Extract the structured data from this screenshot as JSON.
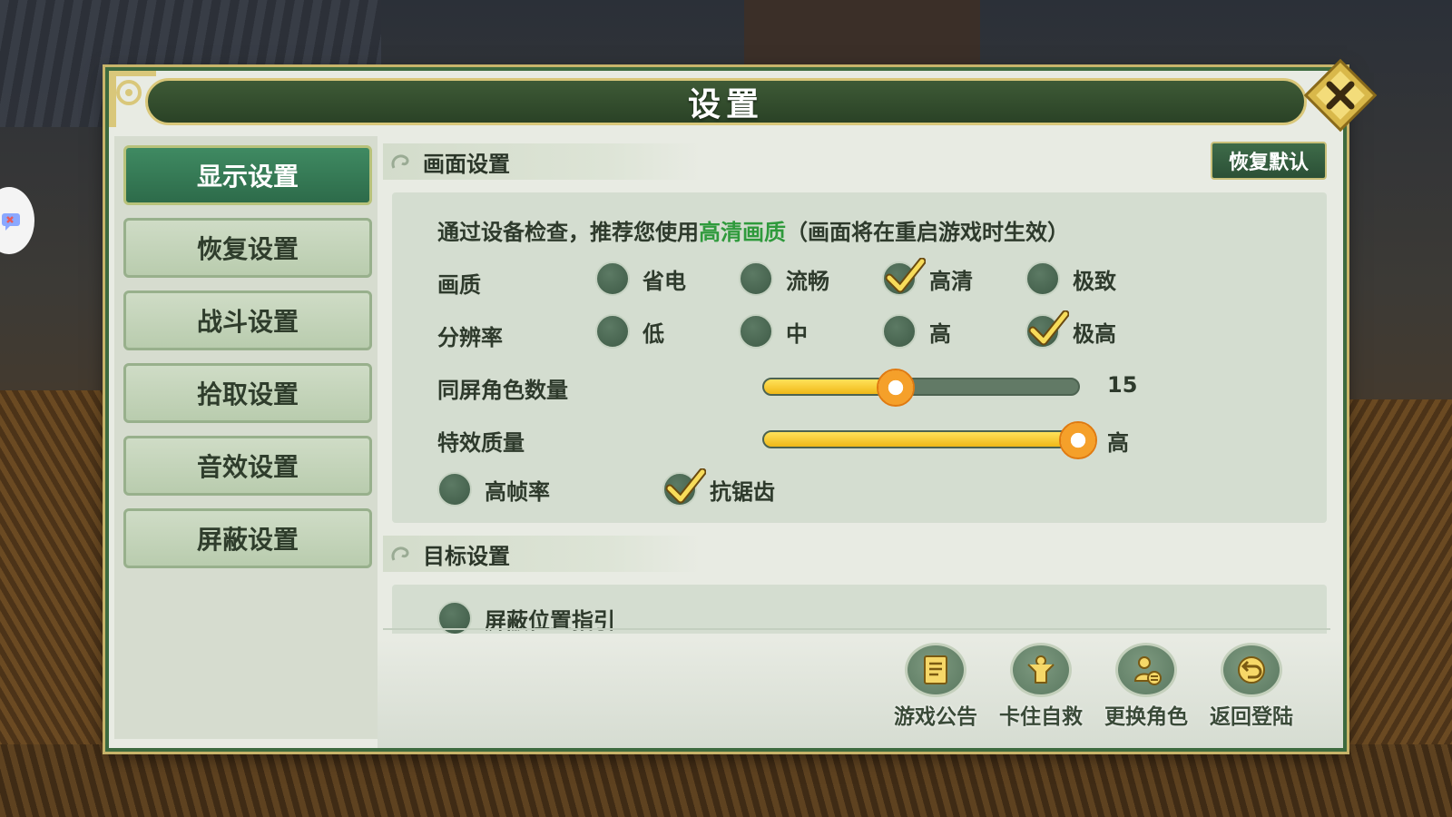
{
  "dialog": {
    "title": "设置"
  },
  "sidebar": {
    "items": [
      {
        "label": "显示设置"
      },
      {
        "label": "恢复设置"
      },
      {
        "label": "战斗设置"
      },
      {
        "label": "拾取设置"
      },
      {
        "label": "音效设置"
      },
      {
        "label": "屏蔽设置"
      }
    ],
    "active_index": 0
  },
  "display": {
    "section_title": "画面设置",
    "restore_default_label": "恢复默认",
    "notice_prefix": "通过设备检查，推荐您使用",
    "notice_highlight": "高清画质",
    "notice_suffix": "（画面将在重启游戏时生效）",
    "quality": {
      "label": "画质",
      "options": [
        "省电",
        "流畅",
        "高清",
        "极致"
      ],
      "selected": "高清"
    },
    "resolution": {
      "label": "分辨率",
      "options": [
        "低",
        "中",
        "高",
        "极高"
      ],
      "selected": "极高"
    },
    "same_screen": {
      "label": "同屏角色数量",
      "value": "15",
      "fraction": 0.42
    },
    "effects": {
      "label": "特效质量",
      "value": "高",
      "fraction": 1.0
    },
    "high_fps": {
      "label": "高帧率",
      "checked": false
    },
    "anti_alias": {
      "label": "抗锯齿",
      "checked": true
    }
  },
  "target": {
    "section_title": "目标设置",
    "hide_position_guide": {
      "label": "屏蔽位置指引",
      "checked": false
    }
  },
  "actions": [
    {
      "label": "游戏公告",
      "icon": "notice-icon"
    },
    {
      "label": "卡住自救",
      "icon": "rescue-icon"
    },
    {
      "label": "更换角色",
      "icon": "switch-character-icon"
    },
    {
      "label": "返回登陆",
      "icon": "return-icon"
    }
  ],
  "colors": {
    "accent_green": "#2d6b4a",
    "highlight_text": "#2f9a3c",
    "slider_fill": "#f0b818"
  }
}
